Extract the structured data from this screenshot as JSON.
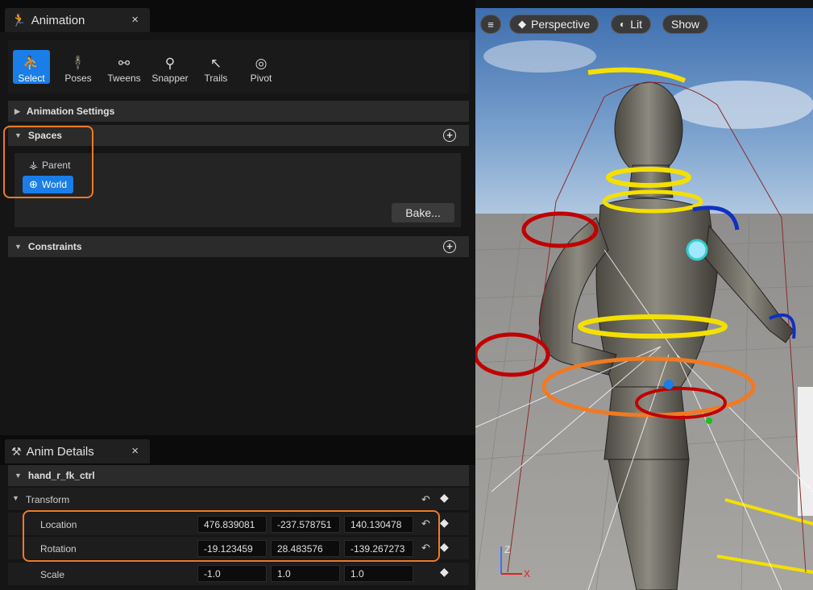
{
  "animation_panel": {
    "tab_title": "Animation",
    "close": "×",
    "toolbar": [
      {
        "label": "Select",
        "icon": "select-icon",
        "active": true
      },
      {
        "label": "Poses",
        "icon": "poses-icon",
        "active": false
      },
      {
        "label": "Tweens",
        "icon": "tweens-icon",
        "active": false
      },
      {
        "label": "Snapper",
        "icon": "snapper-icon",
        "active": false
      },
      {
        "label": "Trails",
        "icon": "trails-icon",
        "active": false
      },
      {
        "label": "Pivot",
        "icon": "pivot-icon",
        "active": false
      }
    ],
    "animation_settings": "Animation Settings",
    "spaces": {
      "title": "Spaces",
      "items": [
        {
          "label": "Parent",
          "icon": "parent-space-icon",
          "selected": false
        },
        {
          "label": "World",
          "icon": "world-icon",
          "selected": true
        }
      ],
      "bake_label": "Bake..."
    },
    "constraints": "Constraints"
  },
  "anim_details": {
    "tab_title": "Anim Details",
    "close": "×",
    "control_name": "hand_r_fk_ctrl",
    "transform_label": "Transform",
    "rows": [
      {
        "label": "Location",
        "values": [
          "476.839081",
          "-237.578751",
          "140.130478"
        ]
      },
      {
        "label": "Rotation",
        "values": [
          "-19.123459",
          "28.483576",
          "-139.267273"
        ]
      },
      {
        "label": "Scale",
        "values": [
          "-1.0",
          "1.0",
          "1.0"
        ]
      }
    ]
  },
  "viewport": {
    "perspective": "Perspective",
    "lit": "Lit",
    "show": "Show",
    "axis_z": "Z",
    "axis_x": "X"
  },
  "colors": {
    "accent": "#1a7de8",
    "highlight": "#f07a23"
  }
}
